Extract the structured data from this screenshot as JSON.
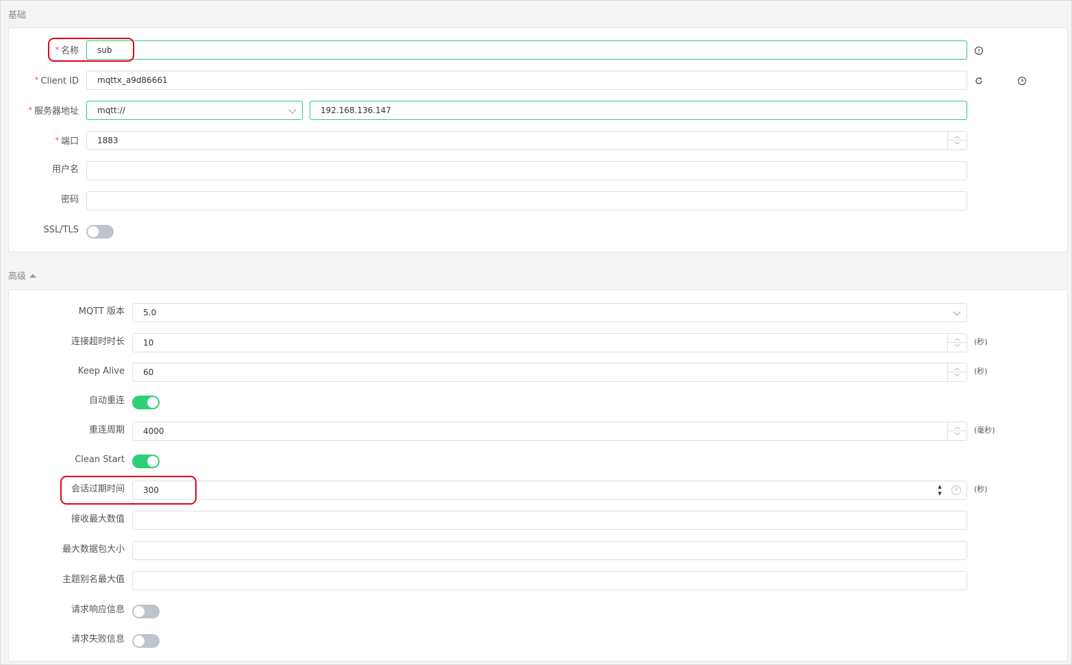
{
  "basic": {
    "title": "基础",
    "name": {
      "label": "名称",
      "value": "sub"
    },
    "client_id": {
      "label": "Client ID",
      "value": "mqttx_a9d86661"
    },
    "server": {
      "label": "服务器地址",
      "protocol": "mqtt://",
      "host": "192.168.136.147"
    },
    "port": {
      "label": "端口",
      "value": "1883"
    },
    "username": {
      "label": "用户名",
      "value": ""
    },
    "password": {
      "label": "密码",
      "value": ""
    },
    "ssl": {
      "label": "SSL/TLS",
      "enabled": false
    }
  },
  "advanced": {
    "title": "高级",
    "mqtt_version": {
      "label": "MQTT 版本",
      "value": "5.0"
    },
    "connect_timeout": {
      "label": "连接超时时长",
      "value": "10",
      "unit": "(秒)"
    },
    "keep_alive": {
      "label": "Keep Alive",
      "value": "60",
      "unit": "(秒)"
    },
    "auto_reconnect": {
      "label": "自动重连",
      "enabled": true
    },
    "reconnect_period": {
      "label": "重连周期",
      "value": "4000",
      "unit": "(毫秒)"
    },
    "clean_start": {
      "label": "Clean Start",
      "enabled": true
    },
    "session_expiry": {
      "label": "会话过期时间",
      "value": "300",
      "unit": "(秒)"
    },
    "receive_maximum": {
      "label": "接收最大数值",
      "value": ""
    },
    "max_packet_size": {
      "label": "最大数据包大小",
      "value": ""
    },
    "topic_alias_max": {
      "label": "主题别名最大值",
      "value": ""
    },
    "request_response_info": {
      "label": "请求响应信息",
      "enabled": false
    },
    "request_problem_info": {
      "label": "请求失败信息",
      "enabled": false
    }
  },
  "colors": {
    "accent": "#34c388",
    "toggle_on": "#2dcf77",
    "highlight": "#e0000f"
  },
  "icons": [
    "info-icon",
    "refresh-icon",
    "clock-icon",
    "chevron-down-icon",
    "caret-up-icon",
    "clear-icon"
  ]
}
